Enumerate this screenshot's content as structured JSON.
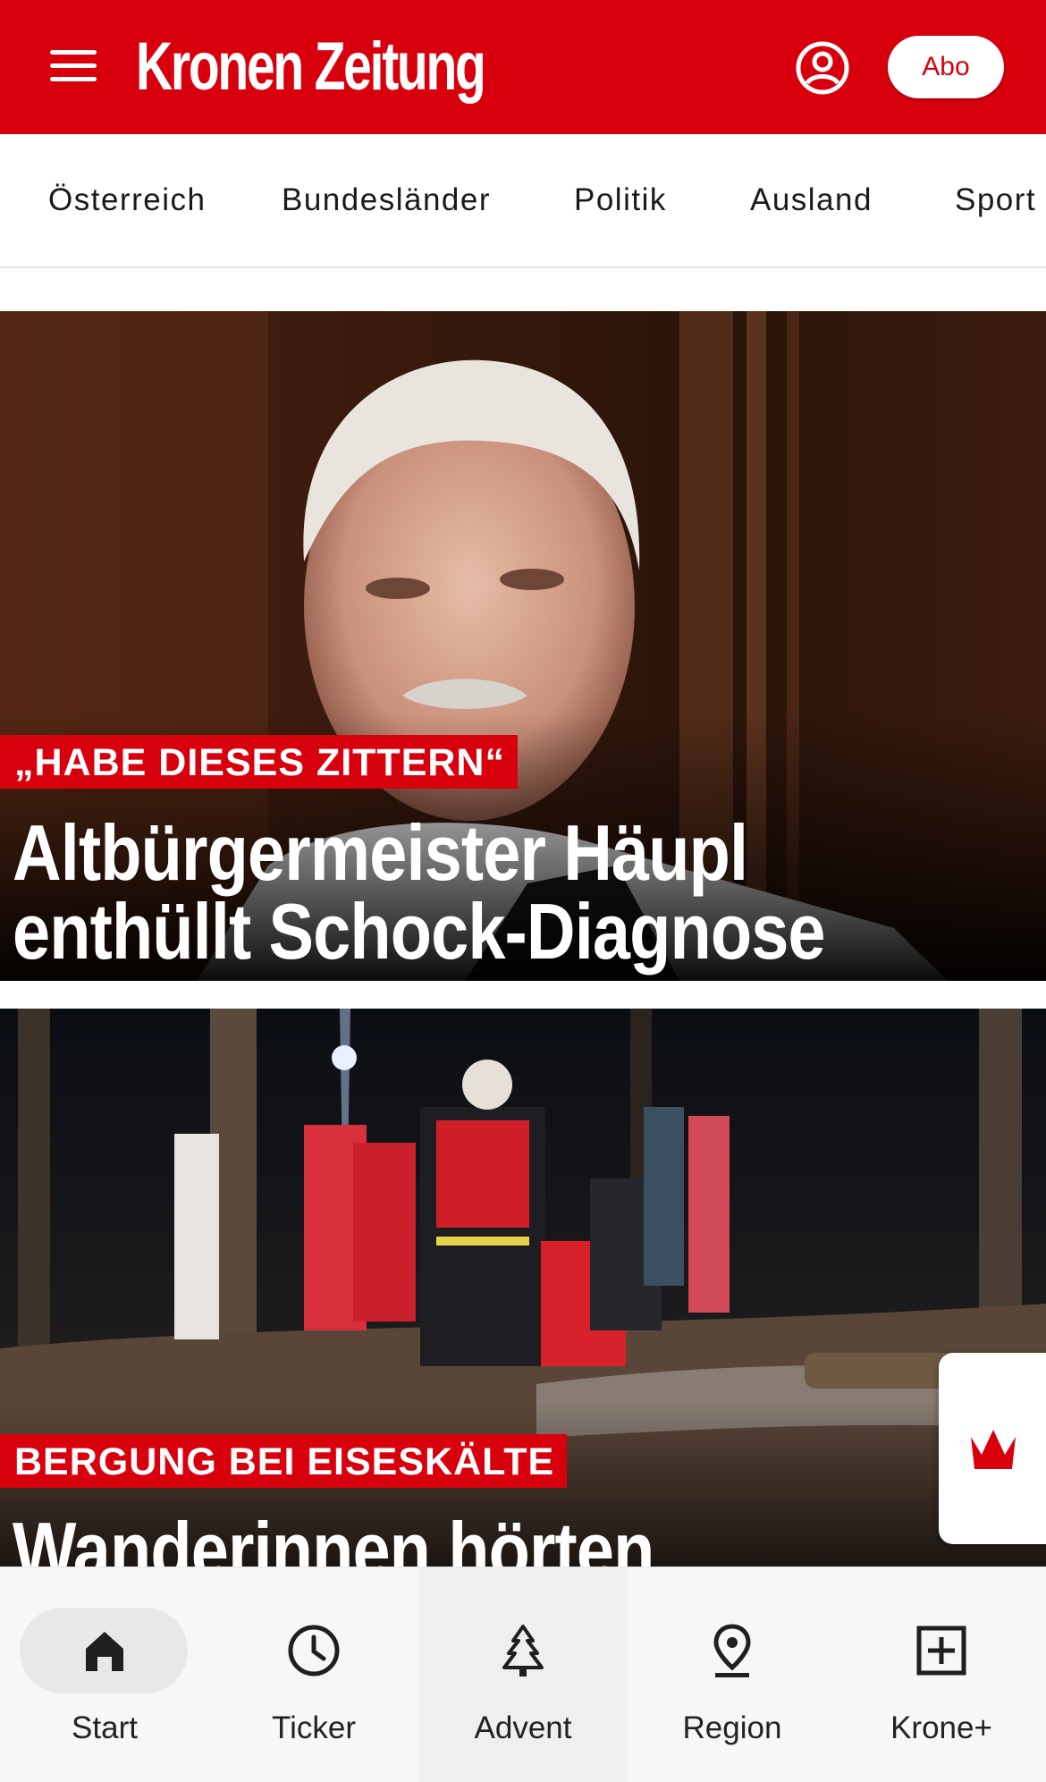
{
  "header": {
    "logo": "Kronen Zeitung",
    "abo_label": "Abo",
    "brand_color": "#d9000d",
    "menu_icon": "hamburger-icon",
    "account_icon": "account-icon"
  },
  "categories": [
    "Österreich",
    "Bundesländer",
    "Politik",
    "Ausland",
    "Sport"
  ],
  "articles": [
    {
      "kicker": "„HABE DIESES ZITTERN“",
      "headline_line1": "Altbürgermeister Häupl",
      "headline_line2": "enthüllt Schock-Diagnose"
    },
    {
      "kicker": "BERGUNG BEI EISESKÄLTE",
      "headline_line1": "Wanderinnen hörten"
    }
  ],
  "floating_tab": {
    "icon": "crown-icon"
  },
  "bottom_nav": {
    "items": [
      {
        "label": "Start",
        "icon": "home-icon",
        "active": true
      },
      {
        "label": "Ticker",
        "icon": "clock-icon"
      },
      {
        "label": "Advent",
        "icon": "tree-icon"
      },
      {
        "label": "Region",
        "icon": "location-pin-icon"
      },
      {
        "label": "Krone+",
        "icon": "plus-box-icon"
      }
    ]
  }
}
